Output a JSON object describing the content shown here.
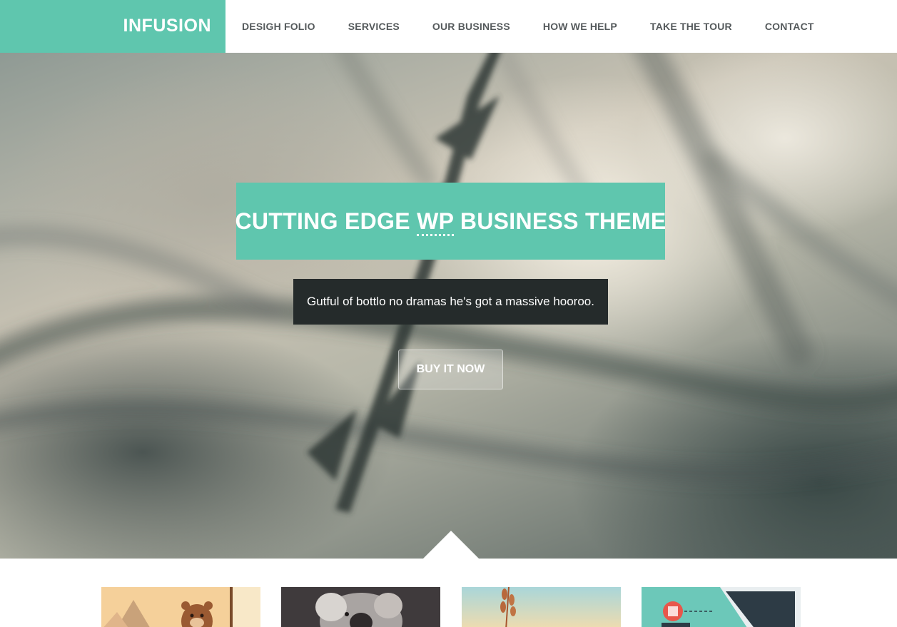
{
  "header": {
    "logo": "INFUSION",
    "nav": [
      "DESIGH FOLIO",
      "SERVICES",
      "OUR BUSINESS",
      "HOW WE HELP",
      "TAKE THE TOUR",
      "CONTACT"
    ]
  },
  "hero": {
    "title_before": "CUTTING EDGE ",
    "title_abbr": "WP",
    "title_after": " BUSINESS THEME",
    "subtitle": "Gutful of bottlo no dramas he's got a massive hooroo.",
    "button": "BUY IT NOW"
  },
  "colors": {
    "accent": "#5fc6ae",
    "dark_box": "#252b2b",
    "nav_text": "#555a5c"
  },
  "thumbnails": [
    {
      "icon": "bear-illustration-icon"
    },
    {
      "icon": "koala-photo-icon"
    },
    {
      "icon": "wheat-photo-icon"
    },
    {
      "icon": "smartphone-illustration-icon"
    }
  ]
}
